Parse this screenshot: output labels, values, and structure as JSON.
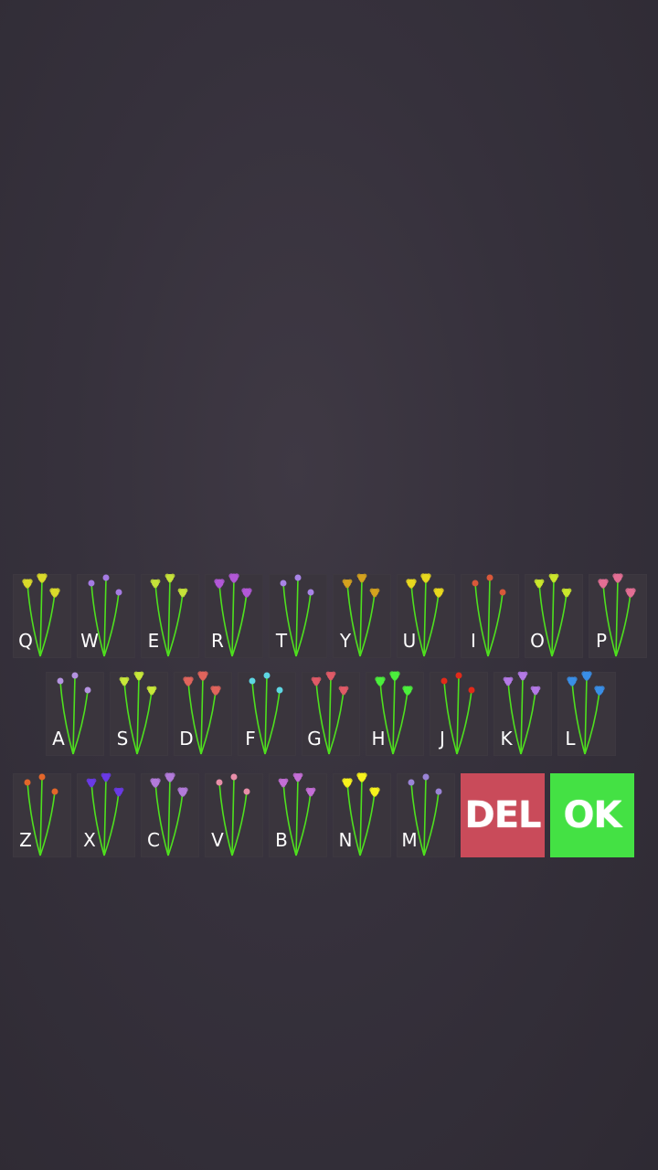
{
  "keyboard": {
    "rows": [
      [
        {
          "letter": "Q",
          "flower": "yellow-bloom",
          "color": "#d9d92a"
        },
        {
          "letter": "W",
          "flower": "violet-bells",
          "color": "#a57be3"
        },
        {
          "letter": "E",
          "flower": "lime-sprigs",
          "color": "#c6e23a"
        },
        {
          "letter": "R",
          "flower": "purple-daisy",
          "color": "#b258d6"
        },
        {
          "letter": "T",
          "flower": "lilac-bloom",
          "color": "#a884e6"
        },
        {
          "letter": "Y",
          "flower": "gold-violet-mix",
          "color": "#d4a21f"
        },
        {
          "letter": "U",
          "flower": "yellow-star",
          "color": "#e8d81f"
        },
        {
          "letter": "I",
          "flower": "red-berries",
          "color": "#d9583a"
        },
        {
          "letter": "O",
          "flower": "lime-clusters",
          "color": "#cbe62d"
        },
        {
          "letter": "P",
          "flower": "pink-bloom",
          "color": "#e36f94"
        }
      ],
      [
        {
          "letter": "A",
          "flower": "lavender-spray",
          "color": "#b493e0"
        },
        {
          "letter": "S",
          "flower": "lime-tulips",
          "color": "#c8e83a"
        },
        {
          "letter": "D",
          "flower": "coral-tulips",
          "color": "#e0645c"
        },
        {
          "letter": "F",
          "flower": "cyan-bloom",
          "color": "#5ed6e3"
        },
        {
          "letter": "G",
          "flower": "rose-bloom",
          "color": "#e05a67"
        },
        {
          "letter": "H",
          "flower": "green-clover",
          "color": "#4bef3c"
        },
        {
          "letter": "J",
          "flower": "red-poppy",
          "color": "#e12a1a"
        },
        {
          "letter": "K",
          "flower": "violet-tulips",
          "color": "#b479e6"
        },
        {
          "letter": "L",
          "flower": "blue-bells",
          "color": "#3a8ee6"
        }
      ],
      [
        {
          "letter": "Z",
          "flower": "orange-bloom",
          "color": "#e3662a"
        },
        {
          "letter": "X",
          "flower": "indigo-bells",
          "color": "#6a3ae6"
        },
        {
          "letter": "C",
          "flower": "purple-bloom",
          "color": "#b27ad9"
        },
        {
          "letter": "V",
          "flower": "pink-clusters",
          "color": "#e88ea9"
        },
        {
          "letter": "B",
          "flower": "magenta-bloom",
          "color": "#c46fd6"
        },
        {
          "letter": "N",
          "flower": "yellow-buttercup",
          "color": "#f7f21c"
        },
        {
          "letter": "M",
          "flower": "lavender-sprigs",
          "color": "#9a84d6"
        }
      ]
    ],
    "delete_label": "DEL",
    "ok_label": "OK",
    "colors": {
      "background": "#36313c",
      "key": "#3a353d",
      "stem": "#4ee01e",
      "delete": "#c94b5a",
      "ok": "#44e144"
    }
  }
}
